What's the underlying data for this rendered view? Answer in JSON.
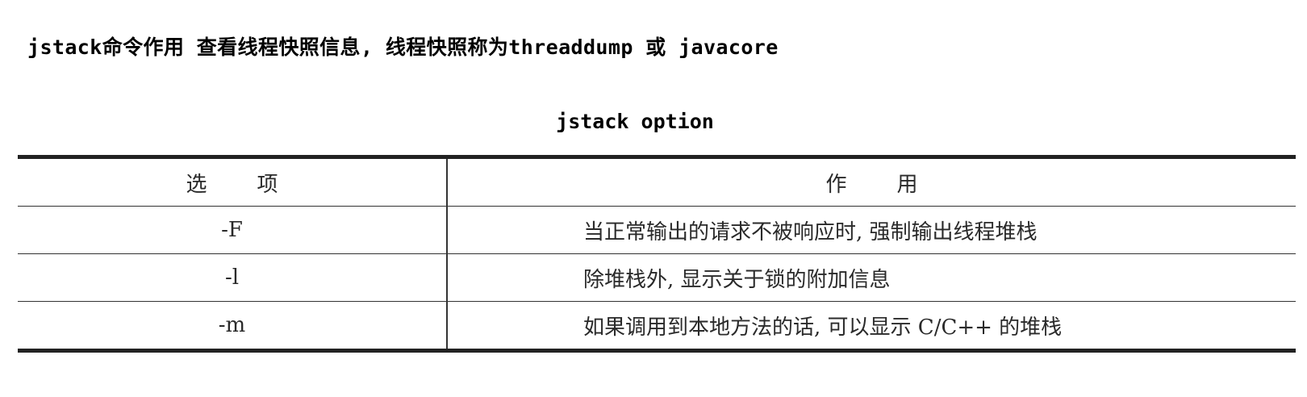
{
  "heading": "jstack命令作用 查看线程快照信息, 线程快照称为threaddump 或 javacore",
  "table": {
    "title": "jstack option",
    "headers": {
      "option": "选项",
      "purpose": "作用"
    },
    "rows": [
      {
        "option": "-F",
        "purpose": "当正常输出的请求不被响应时, 强制输出线程堆栈"
      },
      {
        "option": "-l",
        "purpose": "除堆栈外, 显示关于锁的附加信息"
      },
      {
        "option": "-m",
        "purpose": "如果调用到本地方法的话, 可以显示 C/C++ 的堆栈"
      }
    ]
  }
}
